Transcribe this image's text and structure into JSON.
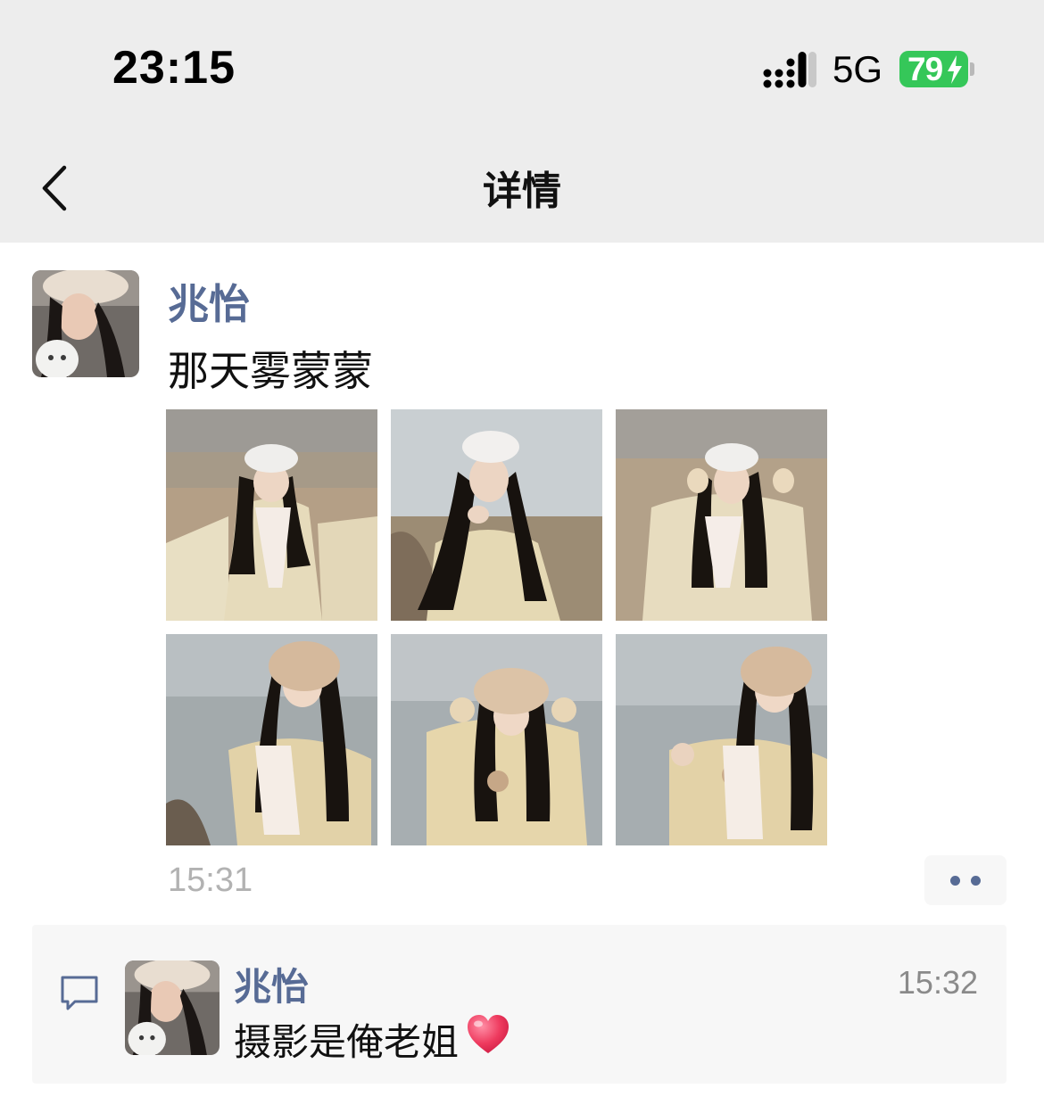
{
  "status_bar": {
    "time": "23:15",
    "network": "5G",
    "battery": "79",
    "signal_icon": "cellular-signal-icon",
    "battery_icon": "battery-charging-icon"
  },
  "nav": {
    "title": "详情",
    "back_icon": "chevron-left-icon"
  },
  "post": {
    "author": "兆怡",
    "text": "那天雾蒙蒙",
    "photo_count": 6,
    "time": "15:31",
    "more_icon": "more-dots-icon"
  },
  "comments": [
    {
      "author": "兆怡",
      "text": "摄影是俺老姐",
      "emoji": "heart-icon",
      "time": "15:32"
    }
  ],
  "colors": {
    "bar_background": "#ededed",
    "link_name": "#576b95",
    "battery": "#35c759",
    "comment_background": "#f7f7f7",
    "timestamp": "#b2b2b2"
  }
}
